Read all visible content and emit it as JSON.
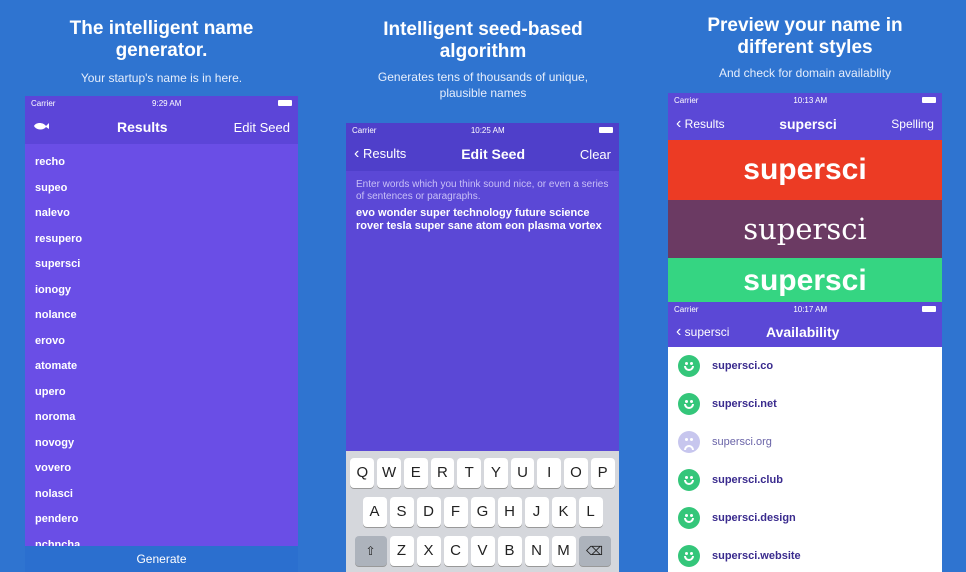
{
  "panels": [
    {
      "heading": "The intelligent name generator.",
      "sub": "Your startup's name is in here.",
      "status": {
        "carrier": "Carrier",
        "time": "9:29 AM"
      },
      "nav": {
        "title": "Results",
        "right": "Edit Seed",
        "left_icon": "whale-icon"
      },
      "names": [
        "recho",
        "supeo",
        "nalevo",
        "resupero",
        "supersci",
        "ionogy",
        "nolance",
        "erovo",
        "atomate",
        "upero",
        "noroma",
        "novogy",
        "vovero",
        "nolasci",
        "pendero",
        "nchncha"
      ],
      "bottom_button": "Generate"
    },
    {
      "heading": "Intelligent seed-based algorithm",
      "sub": "Generates tens of thousands of unique, plausible names",
      "status": {
        "carrier": "Carrier",
        "time": "10:25 AM"
      },
      "nav": {
        "back": "Results",
        "title": "Edit Seed",
        "right": "Clear"
      },
      "placeholder": "Enter words which you think sound nice, or even a series of sentences or paragraphs.",
      "seed_text": "evo wonder super technology future science rover tesla super sane atom eon plasma vortex",
      "keyboard": {
        "row1": [
          "Q",
          "W",
          "E",
          "R",
          "T",
          "Y",
          "U",
          "I",
          "O",
          "P"
        ],
        "row2": [
          "A",
          "S",
          "D",
          "F",
          "G",
          "H",
          "J",
          "K",
          "L"
        ],
        "row3": [
          "Z",
          "X",
          "C",
          "V",
          "B",
          "N",
          "M"
        ],
        "shift_icon": "shift-icon",
        "delete_icon": "backspace-icon"
      }
    },
    {
      "heading": "Preview your name in different styles",
      "sub": "And check for domain availablity",
      "status": {
        "carrier": "Carrier",
        "time": "10:13 AM"
      },
      "nav": {
        "back": "Results",
        "title": "supersci",
        "right": "Spelling"
      },
      "styles": [
        "supersci",
        "supersci",
        "supersci"
      ],
      "colors": {
        "red": "#ec3b24",
        "plum": "#6b3a63",
        "green": "#35d582"
      },
      "status2": {
        "carrier": "Carrier",
        "time": "10:17 AM"
      },
      "nav2": {
        "back": "supersci",
        "title": "Availability"
      },
      "domains": [
        {
          "name": "supersci.co",
          "available": true
        },
        {
          "name": "supersci.net",
          "available": true
        },
        {
          "name": "supersci.org",
          "available": false
        },
        {
          "name": "supersci.club",
          "available": true
        },
        {
          "name": "supersci.design",
          "available": true
        },
        {
          "name": "supersci.website",
          "available": true
        }
      ]
    }
  ]
}
